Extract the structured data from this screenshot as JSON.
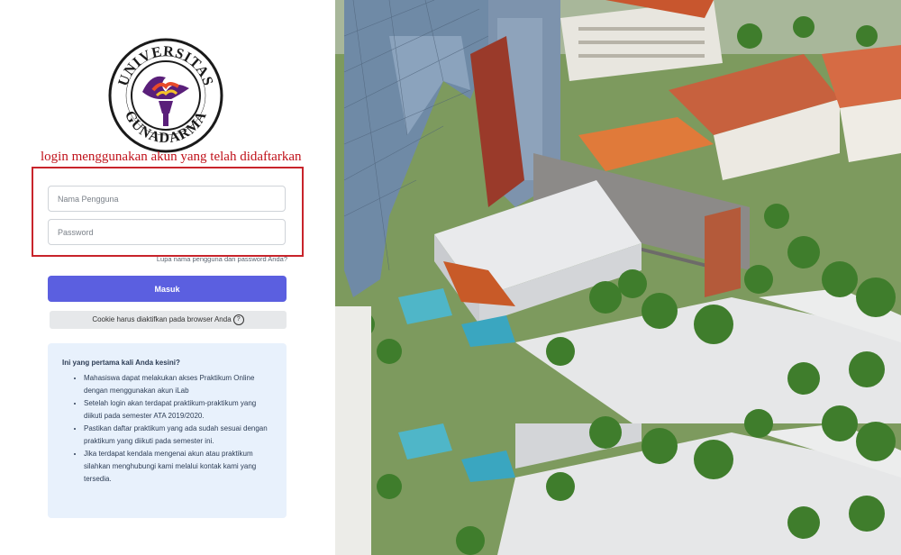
{
  "logo": {
    "text_top": "UNIVERSITAS",
    "text_bottom": "GUNADARMA"
  },
  "annotation": "login menggunakan akun yang telah didaftarkan",
  "form": {
    "username_placeholder": "Nama Pengguna",
    "password_placeholder": "Password",
    "forgot_link": "Lupa nama pengguna dan password Anda?",
    "login_button": "Masuk",
    "cookie_notice": "Cookie harus diaktifkan pada browser Anda"
  },
  "info": {
    "title": "Ini yang pertama kali Anda kesini?",
    "items": [
      "Mahasiswa dapat melakukan akses Praktikum Online dengan menggunakan akun iLab",
      "Setelah login akan terdapat praktikum-praktikum yang diikuti pada semester ATA 2019/2020.",
      "Pastikan daftar praktikum yang ada sudah sesuai dengan praktikum yang diikuti pada semester ini.",
      "Jika terdapat kendala mengenai akun atau praktikum silahkan menghubungi kami melalui kontak kami yang tersedia."
    ]
  },
  "colors": {
    "primary": "#5b5fe0",
    "annotation_red": "#c0111a",
    "info_bg": "#e8f1fc",
    "logo_purple": "#5a1f7a"
  },
  "icons": {
    "help": "question-circle-icon"
  }
}
